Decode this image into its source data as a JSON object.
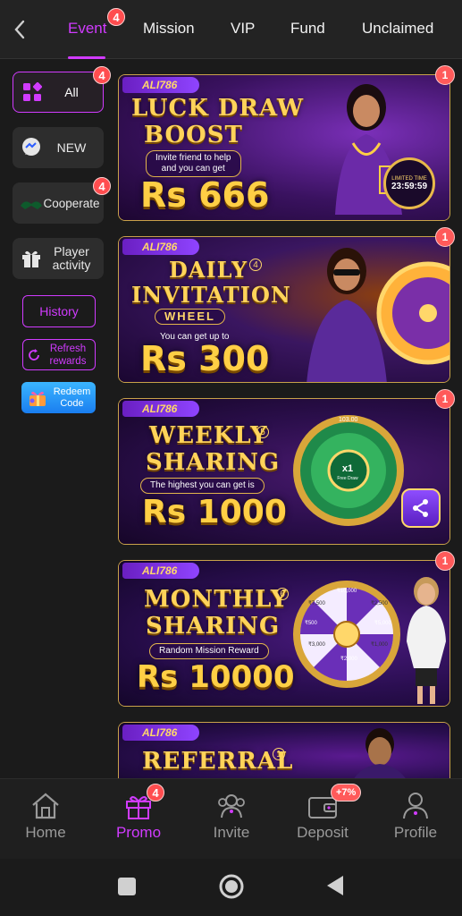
{
  "tabs": [
    {
      "label": "Event",
      "badge": "4",
      "active": true
    },
    {
      "label": "Mission"
    },
    {
      "label": "VIP"
    },
    {
      "label": "Fund"
    },
    {
      "label": "Unclaimed"
    }
  ],
  "sidebar": {
    "items": [
      {
        "label": "All",
        "badge": "4",
        "icon": "grid-icon"
      },
      {
        "label": "NEW",
        "icon": "chat-bubble-icon"
      },
      {
        "label": "Cooperate",
        "badge": "4",
        "icon": "handshake-icon"
      },
      {
        "label": "Player activity",
        "icon": "gift-icon"
      }
    ],
    "history_label": "History",
    "refresh_label": "Refresh rewards",
    "redeem_label": "Redeem Code"
  },
  "banners": [
    {
      "brand": "ALI786",
      "title1": "LUCK DRAW",
      "title2": "BOOST",
      "subtitle": "Invite friend to help\nand you can get",
      "amount": "Rs 666",
      "timer_label": "LIMITED TIME",
      "timer": "23:59:59",
      "badge": "1"
    },
    {
      "brand": "ALI786",
      "title1": "DAILY",
      "title_num": "4",
      "title2": "INVITATION",
      "title3": "WHEEL",
      "subtitle": "You can get up to",
      "amount": "Rs 300",
      "badge": "1"
    },
    {
      "brand": "ALI786",
      "title1": "WEEKLY",
      "title_num": "5",
      "title2": "SHARING",
      "subtitle": "The highest you can get is",
      "amount": "Rs 1000",
      "wheel_top": "103.00",
      "wheel_center": "x1",
      "wheel_center_sub": "Free Draw",
      "badge": "1"
    },
    {
      "brand": "ALI786",
      "title1": "MONTHLY",
      "title_num": "6",
      "title2": "SHARING",
      "subtitle": "Random Mission Reward",
      "amount": "Rs 10000",
      "wheel_values": [
        "₹10,000",
        "₹2,500",
        "₹5,000",
        "₹1,000",
        "₹2,000",
        "₹3,000",
        "₹500",
        "₹7,500"
      ],
      "badge": "1"
    },
    {
      "brand": "ALI786",
      "title1": "REFERRAL",
      "title_num": "1"
    }
  ],
  "bottom_nav": [
    {
      "label": "Home",
      "icon": "home-icon"
    },
    {
      "label": "Promo",
      "icon": "gift-box-icon",
      "badge": "4",
      "active": true
    },
    {
      "label": "Invite",
      "icon": "people-icon"
    },
    {
      "label": "Deposit",
      "icon": "wallet-icon",
      "badge": "+7%"
    },
    {
      "label": "Profile",
      "icon": "person-icon"
    }
  ],
  "colors": {
    "accent": "#d13bff",
    "badge": "#ff4d4f",
    "gold": "#ffcf45",
    "background": "#1b1b1b"
  }
}
